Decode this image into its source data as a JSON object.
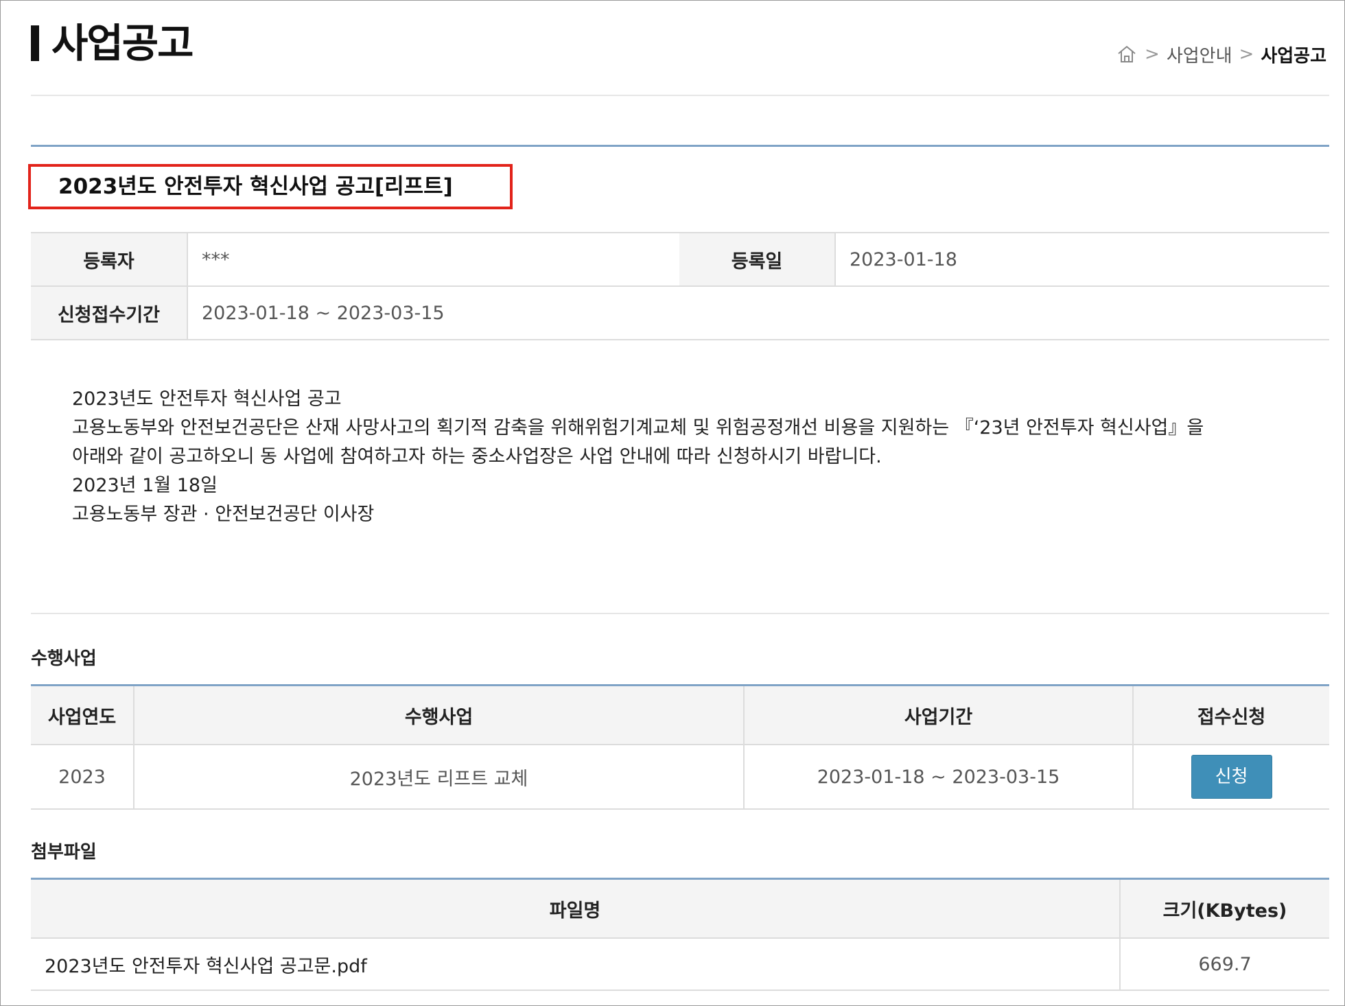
{
  "header": {
    "title": "사업공고",
    "breadcrumb": [
      "사업안내",
      "사업공고"
    ]
  },
  "notice": {
    "title": "2023년도 안전투자 혁신사업 공고[리프트]",
    "registrant_label": "등록자",
    "registrant_value": "***",
    "date_label": "등록일",
    "date_value": "2023-01-18",
    "period_label": "신청접수기간",
    "period_value": "2023-01-18 ~ 2023-03-15",
    "body": [
      "2023년도 안전투자 혁신사업 공고",
      "고용노동부와 안전보건공단은 산재 사망사고의 획기적 감축을 위해위험기계교체 및 위험공정개선 비용을 지원하는 『‘23년 안전투자 혁신사업』을",
      "아래와 같이 공고하오니 동 사업에 참여하고자 하는 중소사업장은 사업 안내에 따라 신청하시기 바랍니다.",
      "2023년 1월 18일",
      "고용노동부 장관 · 안전보건공단 이사장"
    ]
  },
  "projects": {
    "section_label": "수행사업",
    "headers": [
      "사업연도",
      "수행사업",
      "사업기간",
      "접수신청"
    ],
    "rows": [
      {
        "year": "2023",
        "name": "2023년도 리프트 교체",
        "period": "2023-01-18 ~ 2023-03-15",
        "button": "신청"
      }
    ]
  },
  "attachments": {
    "section_label": "첨부파일",
    "headers": [
      "파일명",
      "크기(KBytes)"
    ],
    "rows": [
      {
        "filename": "2023년도 안전투자 혁신사업 공고문.pdf",
        "size": "669.7"
      }
    ]
  }
}
